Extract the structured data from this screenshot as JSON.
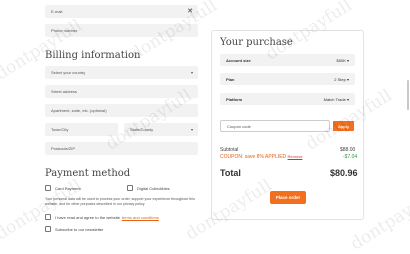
{
  "watermark": "dontpayfull",
  "contact": {
    "email_placeholder": "E-mail",
    "phone_placeholder": "Phone number"
  },
  "billing": {
    "heading": "Billing information",
    "country_placeholder": "Select your country",
    "street_placeholder": "Street address",
    "apartment_placeholder": "Apartment, suite, etc. (optional)",
    "city_placeholder": "Town/City",
    "state_placeholder": "State/County",
    "postcode_placeholder": "Postcode/ZIP"
  },
  "payment": {
    "heading": "Payment method",
    "option_card": "Card Payment",
    "option_digital": "Digital Collectibles",
    "privacy_text_1": "Your personal data will be used to process your order, support your experience throughout this",
    "privacy_text_2": "website, and for other purposes described in our privacy policy.",
    "terms_prefix": "I have read and agree to the website",
    "terms_link": "terms and conditions",
    "newsletter": "Subscribe to our newsletter"
  },
  "summary": {
    "heading": "Your purchase",
    "rows": [
      {
        "label": "Account size",
        "value": "$50K"
      },
      {
        "label": "Plan",
        "value": "2 Step"
      },
      {
        "label": "Platform",
        "value": "Match Trade"
      }
    ],
    "coupon_placeholder": "Coupon code",
    "apply_label": "Apply",
    "subtotal_label": "Subtotal",
    "subtotal_value": "$88.00",
    "coupon_line": "COUPON: save 8% APPLIED",
    "coupon_remove": "Remove",
    "discount_value": "-$7.04",
    "total_label": "Total",
    "total_value": "$80.96",
    "place_order": "Place order"
  },
  "colors": {
    "accent": "#f26f1f",
    "discount_green": "#2e9a3e",
    "coupon_orange": "#e2621b"
  }
}
